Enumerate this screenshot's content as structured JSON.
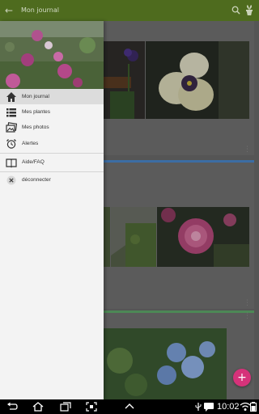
{
  "app": {
    "title": "Mon journal",
    "icons": {
      "back": "back-arrow-icon",
      "search": "search-icon",
      "plant": "plant-pot-icon"
    },
    "accent": "#4e6b1e",
    "fab_color": "#d6327a"
  },
  "drawer": {
    "items": [
      {
        "label": "Mon journal",
        "icon": "home-icon",
        "active": true
      },
      {
        "label": "Mes plantes",
        "icon": "list-icon",
        "active": false
      },
      {
        "label": "Mes photos",
        "icon": "photos-icon",
        "active": false
      },
      {
        "label": "Alertes",
        "icon": "alarm-clock-icon",
        "active": false
      },
      {
        "label": "Aide/FAQ",
        "icon": "book-icon",
        "active": false
      },
      {
        "label": "déconnecter",
        "icon": "close-circle-icon",
        "active": false
      }
    ]
  },
  "fab": {
    "label": "+"
  },
  "status_bar": {
    "time": "10:02"
  },
  "card_colors": [
    "#4a86c8",
    "#5fa66a"
  ]
}
